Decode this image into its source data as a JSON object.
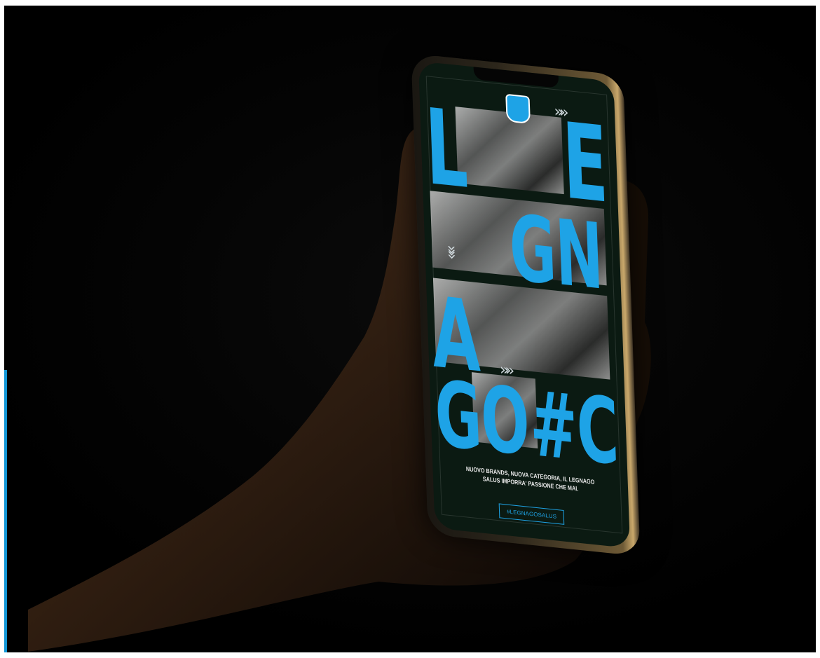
{
  "colors": {
    "accent": "#1ea3e6",
    "background": "#000000",
    "screen_bg": "#0b1a12"
  },
  "poster": {
    "letters": {
      "l": "L",
      "e": "E",
      "gn": "GN",
      "a": "A",
      "go": "GO",
      "hash_c": "#C"
    },
    "caption": "NUOVO BRANDS, NUOVA CATEGORIA, IL LEGNAGO SALUS IMPORRA' PASSIONE CHE MAI.",
    "hashtag": "#LEGNAGOSALUS"
  },
  "icons": {
    "badge": "club-crest-icon",
    "chevrons": "double-chevron-icon"
  }
}
